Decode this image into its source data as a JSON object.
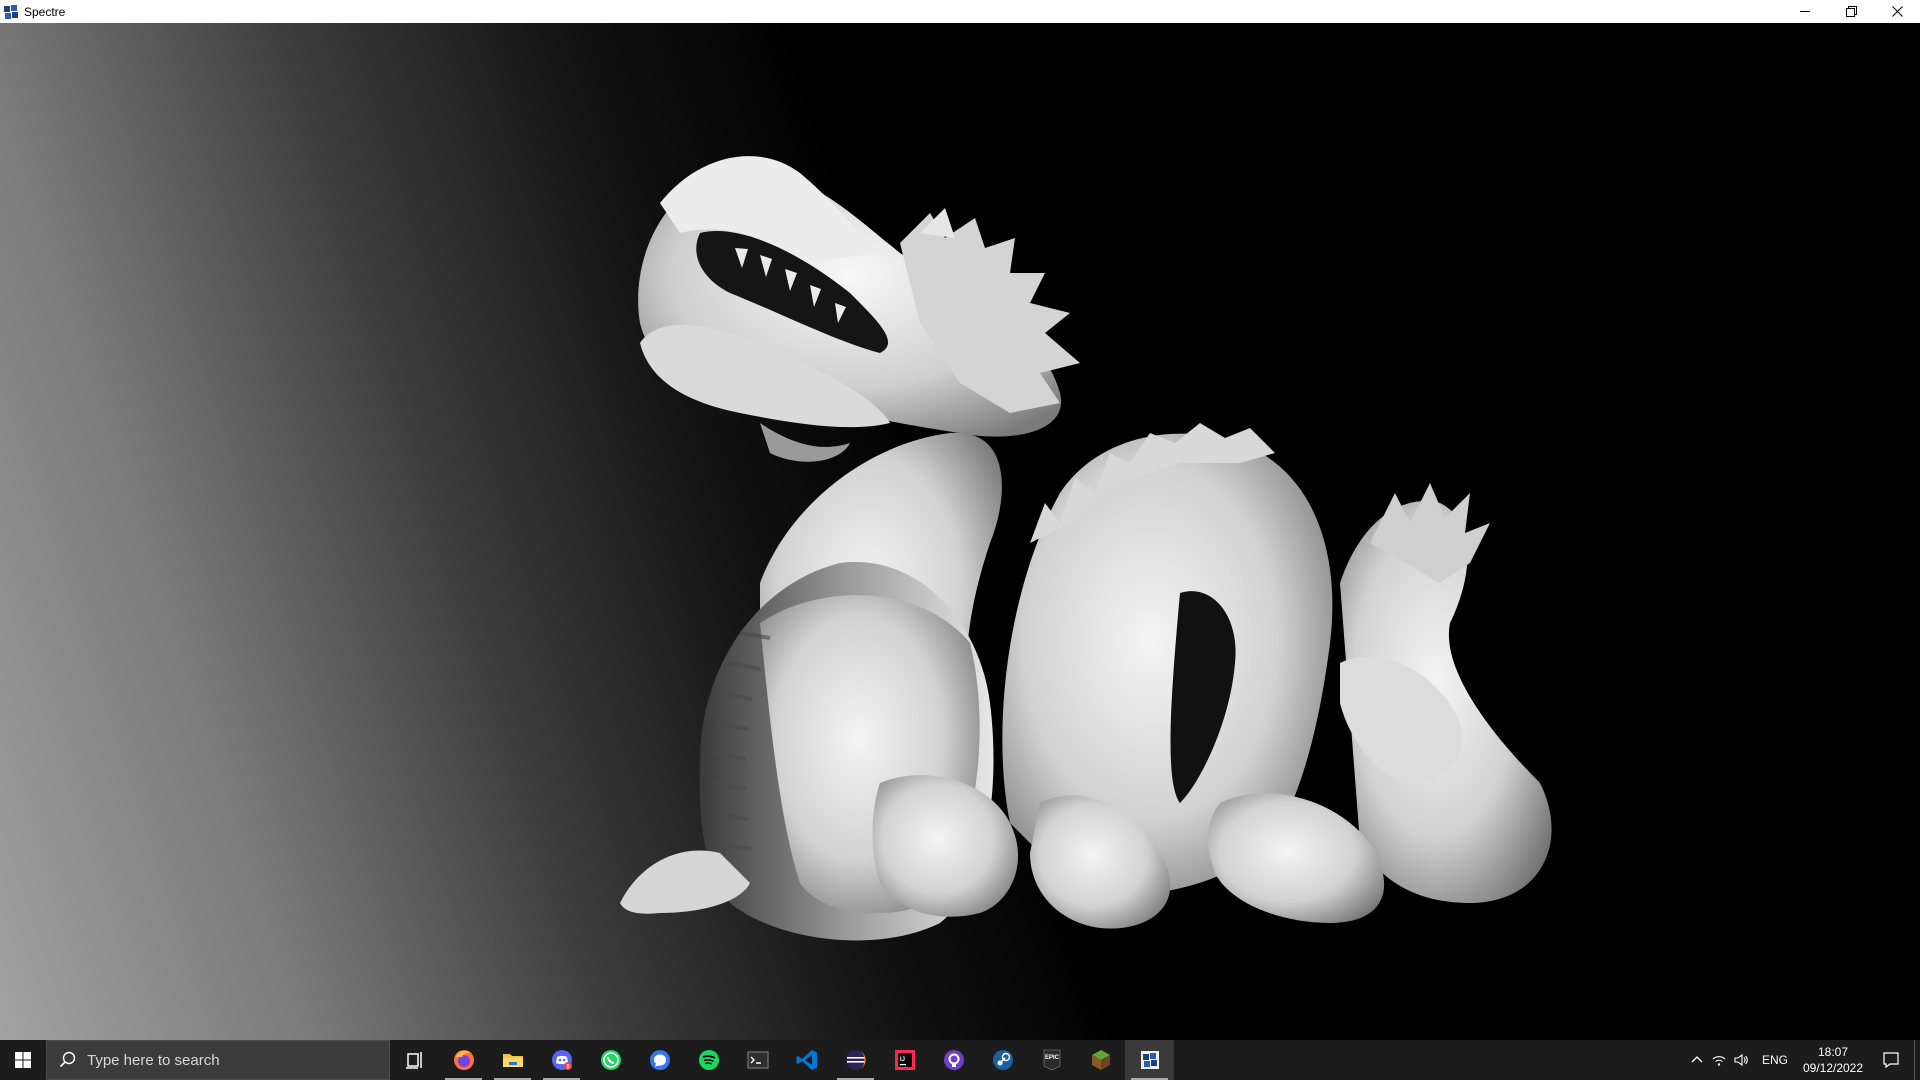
{
  "window": {
    "title": "Spectre",
    "minimize_icon": "minimize-icon",
    "restore_icon": "restore-icon",
    "close_icon": "close-icon"
  },
  "viewport": {
    "background_light": "#a2a2a2",
    "background_dark": "#000000",
    "model_color": "#d8d8d8",
    "content": "stanford-dragon-render"
  },
  "taskbar": {
    "search_placeholder": "Type here to search",
    "apps": [
      {
        "name": "task-view",
        "icon": "task-view-icon"
      },
      {
        "name": "firefox",
        "icon": "firefox-icon",
        "running": true
      },
      {
        "name": "file-explorer",
        "icon": "folder-icon",
        "running": true
      },
      {
        "name": "discord",
        "icon": "discord-icon",
        "running": true,
        "badge": "8"
      },
      {
        "name": "whatsapp",
        "icon": "whatsapp-icon"
      },
      {
        "name": "signal",
        "icon": "chat-bubble-icon"
      },
      {
        "name": "spotify",
        "icon": "spotify-icon"
      },
      {
        "name": "terminal",
        "icon": "terminal-icon"
      },
      {
        "name": "vscode",
        "icon": "vscode-icon"
      },
      {
        "name": "eclipse",
        "icon": "eclipse-icon",
        "running": true
      },
      {
        "name": "intellij",
        "icon": "intellij-icon"
      },
      {
        "name": "github-desktop",
        "icon": "github-icon"
      },
      {
        "name": "steam",
        "icon": "steam-icon"
      },
      {
        "name": "epic-games",
        "icon": "epic-games-icon",
        "label": "EPIC"
      },
      {
        "name": "minecraft",
        "icon": "minecraft-icon"
      },
      {
        "name": "spectre",
        "icon": "spectre-icon",
        "active": true
      }
    ],
    "tray": {
      "language": "ENG",
      "time": "18:07",
      "date": "09/12/2022"
    }
  }
}
